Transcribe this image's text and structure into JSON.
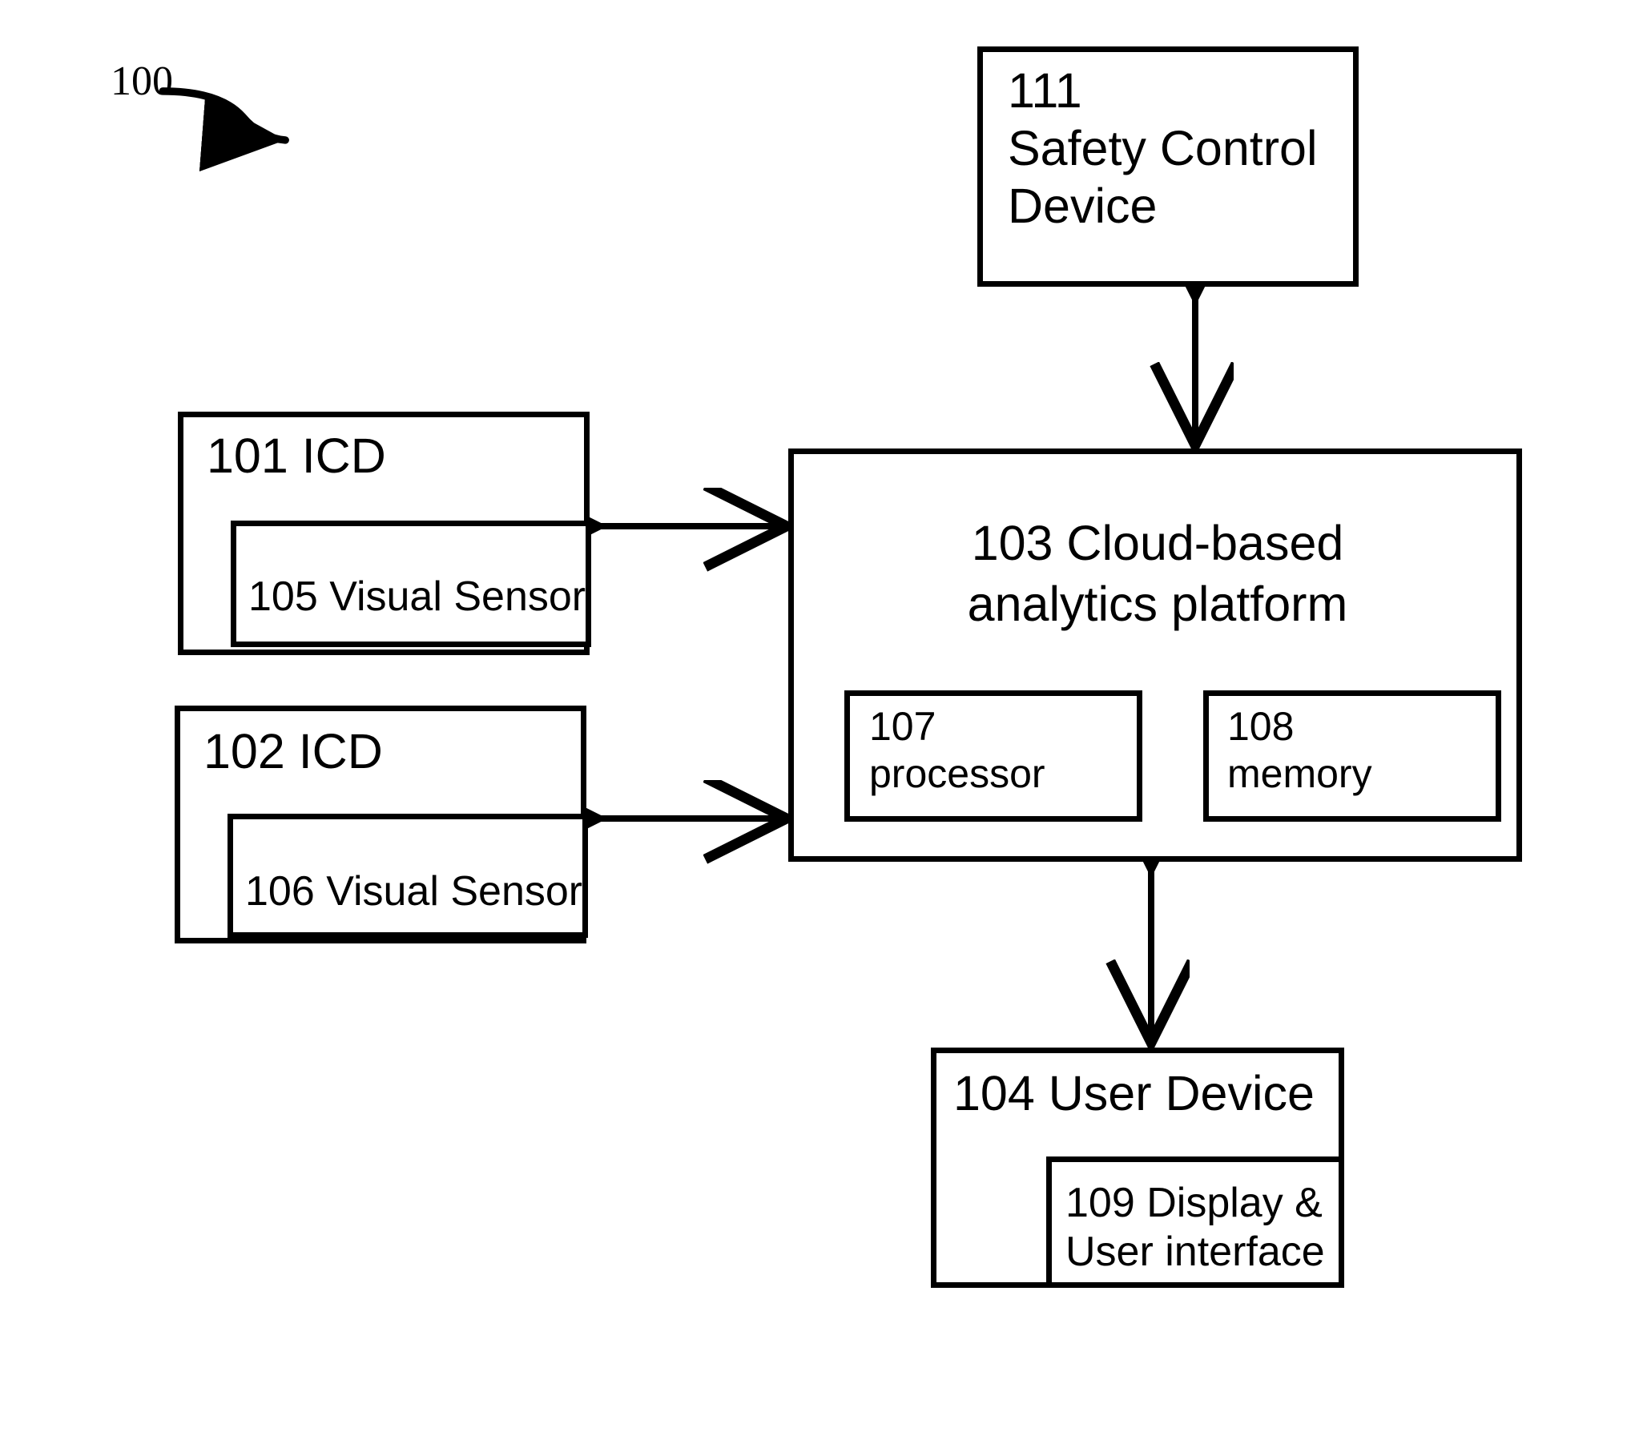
{
  "figure": {
    "reference_numeral": "100",
    "type": "patent-system-block-diagram"
  },
  "nodes": {
    "safety_control_device": {
      "numeral": "111",
      "line1": "111",
      "line2": "Safety Control",
      "line3": "Device",
      "full_label": "111 Safety Control Device"
    },
    "icd_1": {
      "label": "101 ICD",
      "sensor_label": "105 Visual Sensor"
    },
    "icd_2": {
      "label": "102 ICD",
      "sensor_label": "106 Visual Sensor"
    },
    "cloud_platform": {
      "line1": "103 Cloud-based",
      "line2": "analytics platform",
      "full_label": "103 Cloud-based analytics platform"
    },
    "processor": {
      "line1": "107",
      "line2": "processor",
      "full_label": "107 processor"
    },
    "memory": {
      "line1": "108",
      "line2": "memory",
      "full_label": "108 memory"
    },
    "user_device": {
      "label": "104 User Device",
      "display_line1": "109 Display &",
      "display_line2": "User interface",
      "display_full_label": "109 Display & User interface"
    }
  },
  "connections": [
    {
      "name": "safety-control-to-cloud",
      "from": "111",
      "to": "103",
      "style": "double-arrow-vertical"
    },
    {
      "name": "icd1-to-cloud",
      "from": "101",
      "to": "103",
      "style": "double-arrow-horizontal"
    },
    {
      "name": "icd2-to-cloud",
      "from": "102",
      "to": "103",
      "style": "double-arrow-horizontal"
    },
    {
      "name": "processor-to-memory",
      "from": "107",
      "to": "108",
      "style": "double-arrow-horizontal"
    },
    {
      "name": "cloud-to-user-device",
      "from": "103",
      "to": "104",
      "style": "double-arrow-vertical"
    }
  ],
  "colors": {
    "stroke": "#000000",
    "background": "#ffffff"
  }
}
